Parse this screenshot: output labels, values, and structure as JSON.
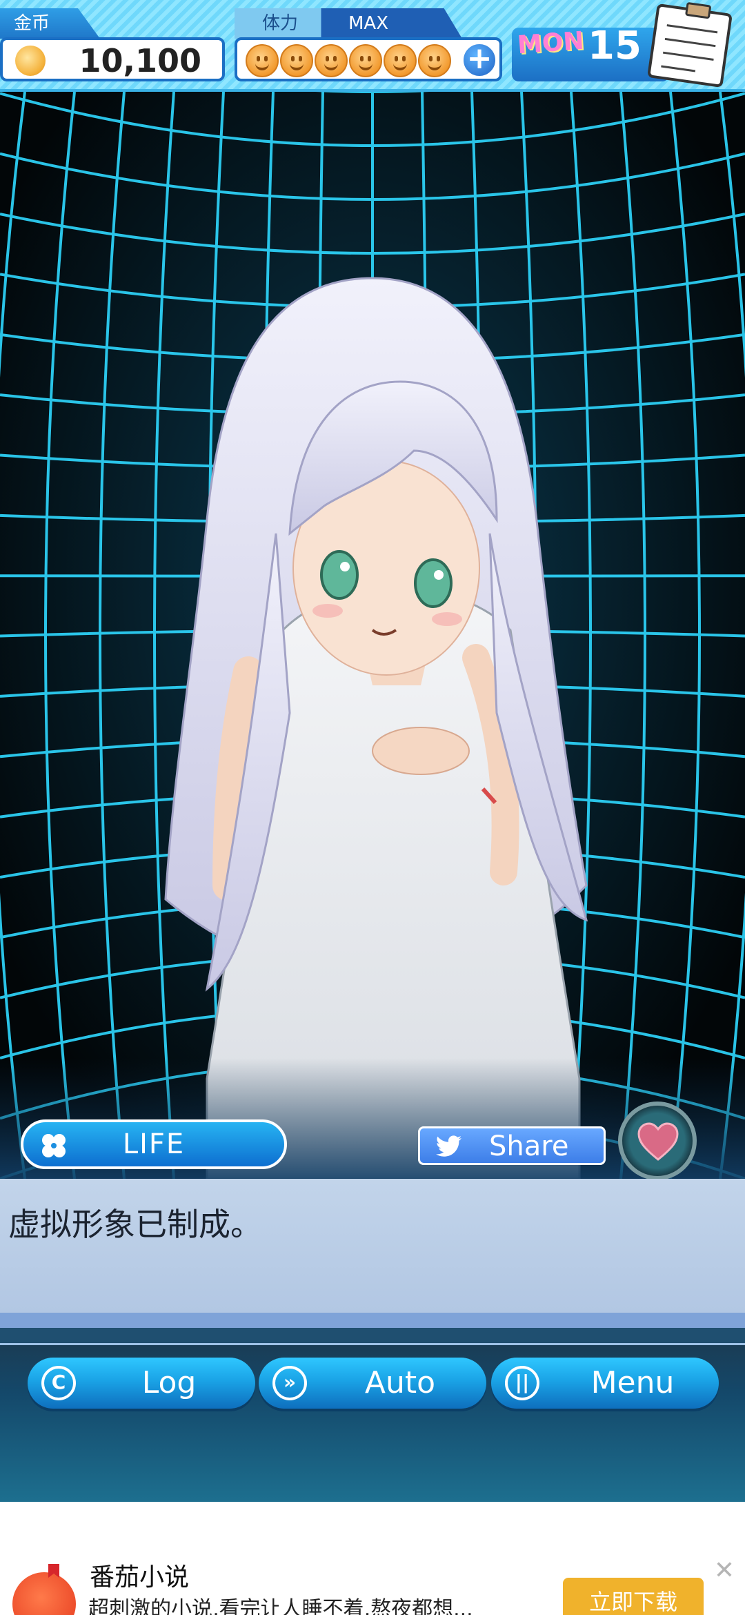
{
  "hud": {
    "coins_label": "金币",
    "coins_value": "10,100",
    "stamina_label": "体力",
    "stamina_status": "MAX",
    "stamina_max_count": 6,
    "stamina_current": 6,
    "day_name": "MON",
    "day_number": "15"
  },
  "scene": {
    "background": "neon grid",
    "character": "girl with long silver hair in white dress"
  },
  "actions": {
    "life_label": "LIFE",
    "share_label": "Share"
  },
  "dialogue": {
    "text": "虚拟形象已制成。"
  },
  "controls": {
    "log_label": "Log",
    "auto_label": "Auto",
    "menu_label": "Menu"
  },
  "ad": {
    "app_name": "番茄小说",
    "description": "超刺激的小说,看完让人睡不着,熬夜都想...",
    "cta_label": "立即下载"
  },
  "colors": {
    "accent": "#1f77c9",
    "hud_bg": "#8fe6ff",
    "grid": "#2fd8ff",
    "dialog_bg": "#c2d4ea",
    "ad_cta": "#f0b22c"
  }
}
